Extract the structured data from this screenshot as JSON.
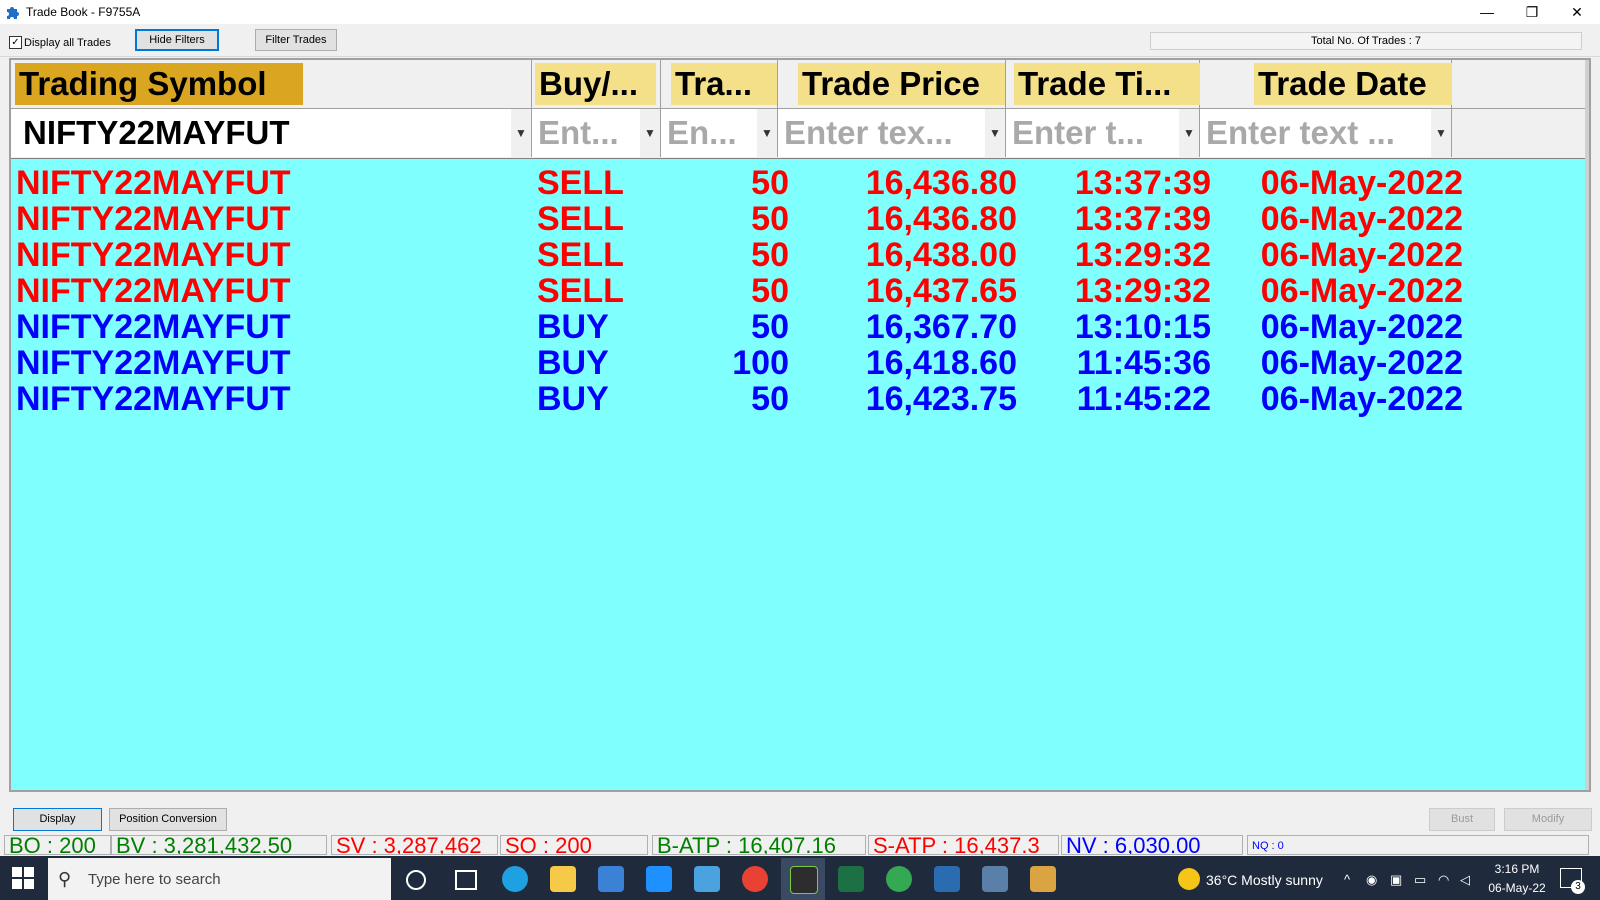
{
  "window": {
    "title": "Trade Book - F9755A",
    "minimize_glyph": "—",
    "restore_glyph": "❐",
    "close_glyph": "✕"
  },
  "toolbar": {
    "display_all_checked": true,
    "display_all_label": "Display all Trades",
    "hide_filters_label": "Hide Filters",
    "filter_trades_label": "Filter Trades",
    "total_trades_text": "Total No. Of Trades : 7"
  },
  "grid": {
    "columns": [
      "Trading Symbol",
      "Buy/...",
      "Tra...",
      "Trade Price",
      "Trade Ti...",
      "Trade Date"
    ],
    "filters": [
      "NIFTY22MAYFUT",
      "Ent...",
      "En...",
      "Enter tex...",
      "Enter t...",
      "Enter text ..."
    ],
    "rows": [
      {
        "symbol": "NIFTY22MAYFUT",
        "side": "SELL",
        "qty": "50",
        "price": "16,436.80",
        "time": "13:37:39",
        "date": "06-May-2022"
      },
      {
        "symbol": "NIFTY22MAYFUT",
        "side": "SELL",
        "qty": "50",
        "price": "16,436.80",
        "time": "13:37:39",
        "date": "06-May-2022"
      },
      {
        "symbol": "NIFTY22MAYFUT",
        "side": "SELL",
        "qty": "50",
        "price": "16,438.00",
        "time": "13:29:32",
        "date": "06-May-2022"
      },
      {
        "symbol": "NIFTY22MAYFUT",
        "side": "SELL",
        "qty": "50",
        "price": "16,437.65",
        "time": "13:29:32",
        "date": "06-May-2022"
      },
      {
        "symbol": "NIFTY22MAYFUT",
        "side": "BUY",
        "qty": "50",
        "price": "16,367.70",
        "time": "13:10:15",
        "date": "06-May-2022"
      },
      {
        "symbol": "NIFTY22MAYFUT",
        "side": "BUY",
        "qty": "100",
        "price": "16,418.60",
        "time": "11:45:36",
        "date": "06-May-2022"
      },
      {
        "symbol": "NIFTY22MAYFUT",
        "side": "BUY",
        "qty": "50",
        "price": "16,423.75",
        "time": "11:45:22",
        "date": "06-May-2022"
      }
    ]
  },
  "colors": {
    "sell": "#ff0000",
    "buy": "#0000ff",
    "grid_bg": "#80ffff",
    "header_symbol_bg": "#daa520",
    "header_bg": "#f5e08a",
    "status_green": "#008000",
    "status_red": "#ff0000",
    "status_blue": "#0000ff"
  },
  "bottom": {
    "display_label": "Display",
    "position_conversion_label": "Position Conversion",
    "bust_label": "Bust",
    "modify_label": "Modify"
  },
  "status": {
    "bo": "BO : 200",
    "bv": "BV : 3,281,432.50",
    "sv": "SV : 3,287,462",
    "so": "SO : 200",
    "batp": "B-ATP : 16,407.16",
    "satp": "S-ATP : 16,437.3",
    "nv": "NV : 6,030.00",
    "nq": "NQ : 0"
  },
  "taskbar": {
    "search_placeholder": "Type here to search",
    "weather": "36°C  Mostly sunny",
    "time": "3:16 PM",
    "date": "06-May-22",
    "notifications": "3",
    "icons": [
      "cortana-icon",
      "task-view-icon",
      "edge-icon",
      "file-explorer-icon",
      "store-icon",
      "mail-icon",
      "remote-icon",
      "chrome-icon",
      "trading-app-icon",
      "excel-icon",
      "chrome-profile-icon",
      "window-icon",
      "calculator-icon",
      "app-icon"
    ]
  }
}
